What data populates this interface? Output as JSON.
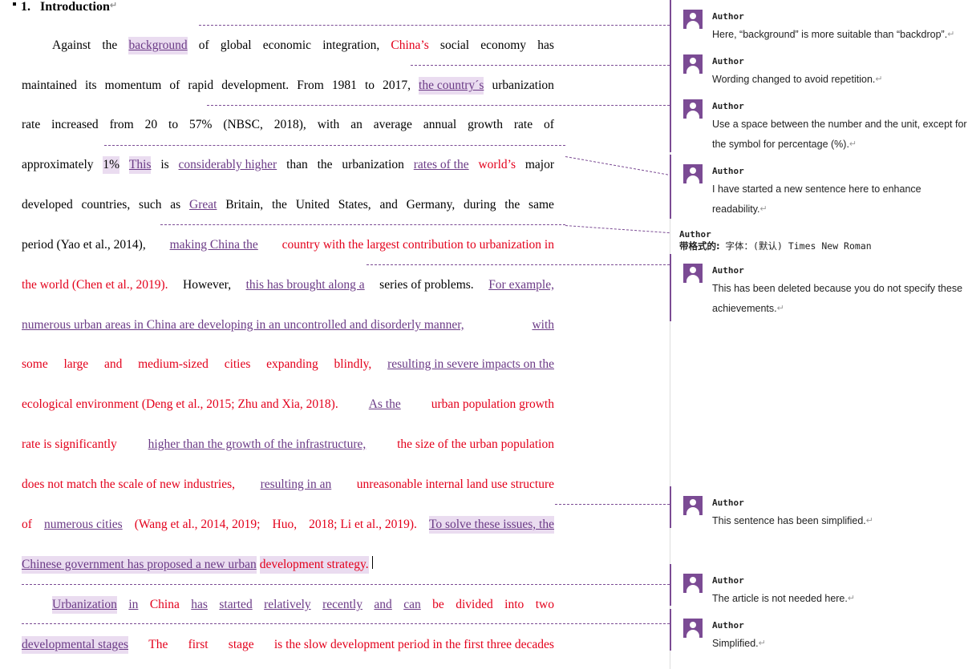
{
  "heading": {
    "number": "1.",
    "title": "Introduction"
  },
  "lines": [
    [
      {
        "t": "Against"
      },
      {
        "t": "the"
      },
      {
        "t": "background",
        "c": "ins hl"
      },
      {
        "t": "of"
      },
      {
        "t": "global"
      },
      {
        "t": "economic"
      },
      {
        "t": "integration,"
      },
      {
        "t": "China’s",
        "c": "red"
      },
      {
        "t": "social"
      },
      {
        "t": "economy"
      },
      {
        "t": "has"
      }
    ],
    [
      {
        "t": "maintained"
      },
      {
        "t": "its"
      },
      {
        "t": "momentum"
      },
      {
        "t": "of"
      },
      {
        "t": "rapid"
      },
      {
        "t": "development."
      },
      {
        "t": "From"
      },
      {
        "t": "1981"
      },
      {
        "t": "to"
      },
      {
        "t": "2017,"
      },
      {
        "t": "the country´s",
        "c": "ins hl"
      },
      {
        "t": "urbanization"
      }
    ],
    [
      {
        "t": "rate"
      },
      {
        "t": "increased"
      },
      {
        "t": "from"
      },
      {
        "t": "20"
      },
      {
        "t": "to"
      },
      {
        "t": "57%"
      },
      {
        "t": "(NBSC,"
      },
      {
        "t": "2018),"
      },
      {
        "t": "with"
      },
      {
        "t": "an"
      },
      {
        "t": "average"
      },
      {
        "t": "annual"
      },
      {
        "t": "growth"
      },
      {
        "t": "rate"
      },
      {
        "t": "of"
      }
    ],
    [
      {
        "t": "approximately"
      },
      {
        "t": "1%",
        "c": "hl"
      },
      {
        "t": "This",
        "c": "ins hl"
      },
      {
        "t": "is"
      },
      {
        "t": "considerably higher",
        "c": "ins"
      },
      {
        "t": "than"
      },
      {
        "t": "the"
      },
      {
        "t": "urbanization"
      },
      {
        "t": "rates of the",
        "c": "ins"
      },
      {
        "t": "world’s",
        "c": "red"
      },
      {
        "t": "major"
      }
    ],
    [
      {
        "t": "developed"
      },
      {
        "t": "countries,"
      },
      {
        "t": "such"
      },
      {
        "t": "as"
      },
      {
        "t": "Great",
        "c": "ins"
      },
      {
        "t": "Britain,"
      },
      {
        "t": "the"
      },
      {
        "t": "United"
      },
      {
        "t": "States,"
      },
      {
        "t": "and"
      },
      {
        "t": "Germany,"
      },
      {
        "t": "during"
      },
      {
        "t": "the"
      },
      {
        "t": "same"
      }
    ],
    [
      {
        "t": "period (Yao et al., 2014),"
      },
      {
        "t": "making China the",
        "c": "ins"
      },
      {
        "t": "country with the largest contribution to urbanization in",
        "c": "red"
      }
    ],
    [
      {
        "t": "the world (Chen et al., 2019).",
        "c": "red"
      },
      {
        "t": "However,"
      },
      {
        "t": "this has brought along a",
        "c": "ins"
      },
      {
        "t": "series of problems."
      },
      {
        "t": "For example,",
        "c": "ins"
      }
    ],
    [
      {
        "t": "numerous urban areas in China are developing in an uncontrolled and disorderly manner,",
        "c": "ins"
      },
      {
        "t": "with",
        "c": "ins"
      }
    ],
    [
      {
        "t": "some",
        "c": "red"
      },
      {
        "t": "large",
        "c": "red"
      },
      {
        "t": "and",
        "c": "red"
      },
      {
        "t": "medium-sized",
        "c": "red"
      },
      {
        "t": "cities",
        "c": "red"
      },
      {
        "t": "expanding",
        "c": "red"
      },
      {
        "t": "blindly,",
        "c": "red"
      },
      {
        "t": "resulting in severe impacts on the",
        "c": "ins"
      }
    ],
    [
      {
        "t": "ecological environment (Deng et al., 2015; Zhu and Xia, 2018).",
        "c": "red"
      },
      {
        "t": "As the",
        "c": "ins"
      },
      {
        "t": "urban population growth",
        "c": "red"
      }
    ],
    [
      {
        "t": "rate is significantly",
        "c": "red"
      },
      {
        "t": "higher than the growth of the infrastructure,",
        "c": "ins"
      },
      {
        "t": "the size of the urban population",
        "c": "red"
      }
    ],
    [
      {
        "t": "does not match the scale of new industries,",
        "c": "red"
      },
      {
        "t": "resulting in an",
        "c": "ins"
      },
      {
        "t": "unreasonable internal land use structure",
        "c": "red"
      }
    ],
    [
      {
        "t": "of",
        "c": "red"
      },
      {
        "t": "numerous cities",
        "c": "ins"
      },
      {
        "t": "(Wang et al., 2014, 2019;",
        "c": "red"
      },
      {
        "t": "Huo,",
        "c": "red"
      },
      {
        "t": "2018; Li et al., 2019).",
        "c": "red"
      },
      {
        "t": "To solve these issues, the",
        "c": "ins hl"
      }
    ],
    [
      {
        "t": "Chinese government has proposed a new urban",
        "c": "ins hl"
      },
      {
        "t": "development strategy.",
        "c": "red hl"
      }
    ],
    [
      {
        "t": "Urbanization",
        "c": "ins hl"
      },
      {
        "t": "in",
        "c": "ins"
      },
      {
        "t": "China",
        "c": "red"
      },
      {
        "t": "has",
        "c": "ins"
      },
      {
        "t": "started",
        "c": "ins"
      },
      {
        "t": "relatively",
        "c": "ins"
      },
      {
        "t": "recently",
        "c": "ins"
      },
      {
        "t": "and",
        "c": "ins"
      },
      {
        "t": "can",
        "c": "ins"
      },
      {
        "t": "be",
        "c": "red"
      },
      {
        "t": "divided",
        "c": "red"
      },
      {
        "t": "into",
        "c": "red"
      },
      {
        "t": "two",
        "c": "red"
      }
    ],
    [
      {
        "t": "developmental stages",
        "c": "ins hl"
      },
      {
        "t": "The",
        "c": "red"
      },
      {
        "t": "first",
        "c": "red"
      },
      {
        "t": "stage",
        "c": "red"
      },
      {
        "t": "is the slow development period in the first three decades",
        "c": "red"
      }
    ]
  ],
  "comments": [
    {
      "author": "Author",
      "text": "Here, “background” is more suitable than “backdrop”."
    },
    {
      "author": "Author",
      "text": "Wording changed to avoid repetition."
    },
    {
      "author": "Author",
      "text": "Use a space between the number and the unit, except for the symbol for percentage (%)."
    },
    {
      "author": "Author",
      "text": "I have started a new sentence here to enhance readability."
    },
    {
      "author": "Author",
      "text": "This has been deleted because you do not specify these achievements."
    },
    {
      "author": "Author",
      "text": "This sentence has been simplified."
    },
    {
      "author": "Author",
      "text": "The article is not needed here."
    },
    {
      "author": "Author",
      "text": "Simplified."
    }
  ],
  "format_note": {
    "author": "Author",
    "label": "带格式的:",
    "value": "字体：(默认) Times New Roman"
  },
  "colors": {
    "deleted_red": "#e3001b",
    "inserted_purple": "#6b3a86",
    "highlight": "#eadcf0"
  }
}
